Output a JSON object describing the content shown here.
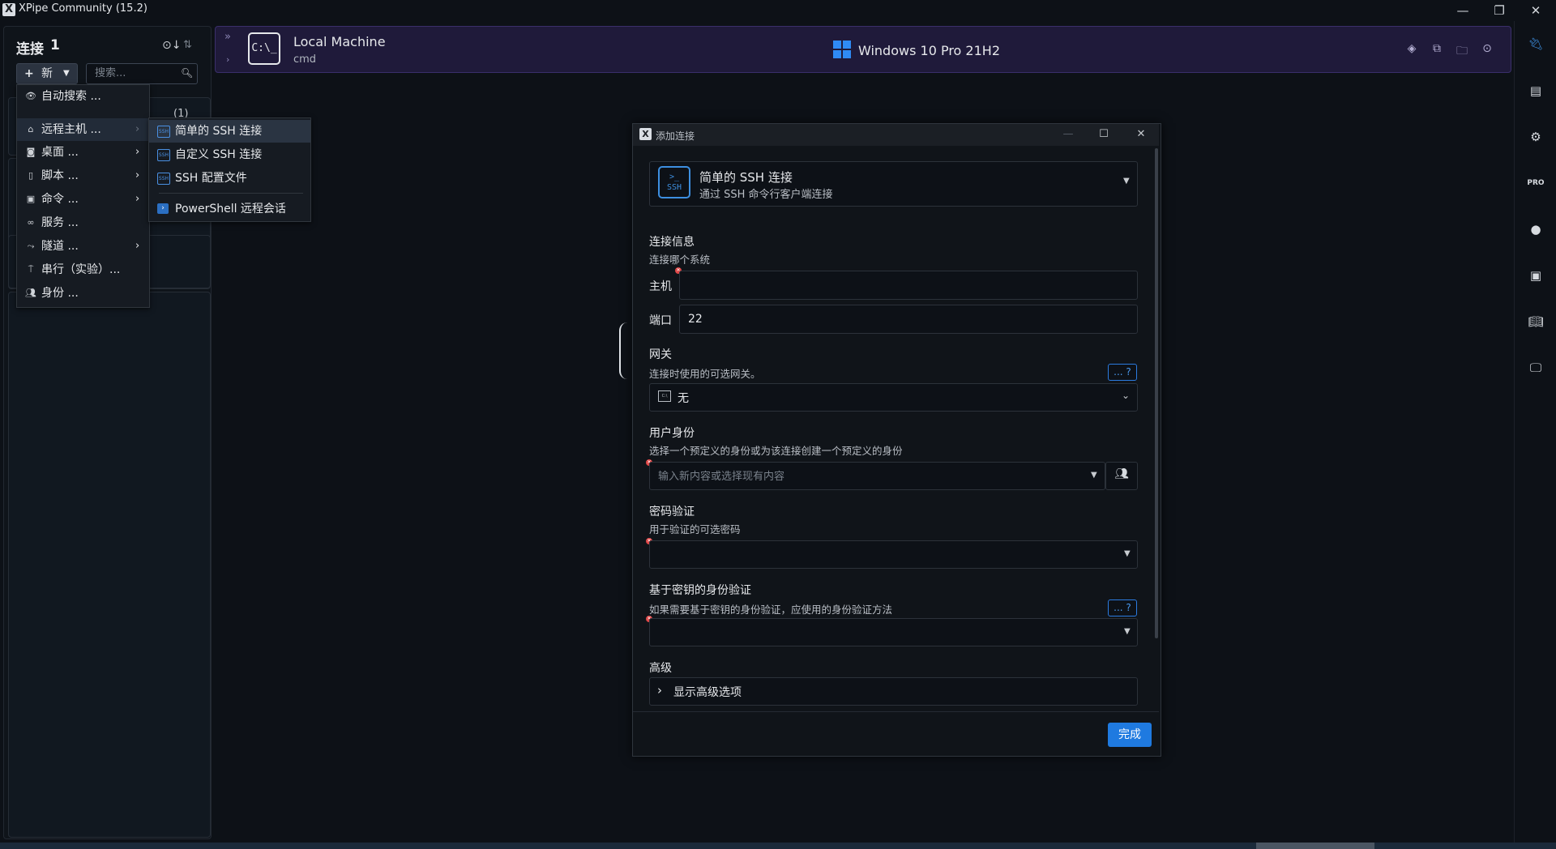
{
  "window": {
    "title": "XPipe Community (15.2)",
    "logo_glyph": "X",
    "minimize": "—",
    "restore": "❐",
    "close": "✕"
  },
  "sidebar": {
    "title": "连接",
    "count": "1",
    "new_button": "新",
    "search_placeholder": "搜索...",
    "card_count": "(1)"
  },
  "new_menu": {
    "items": [
      {
        "label": "自动搜索 ...",
        "icon": "auto-search-icon",
        "has_submenu": false
      },
      {
        "label": "远程主机 ...",
        "icon": "remote-host-icon",
        "has_submenu": true
      },
      {
        "label": "桌面 ...",
        "icon": "desktop-icon",
        "has_submenu": true
      },
      {
        "label": "脚本 ...",
        "icon": "script-icon",
        "has_submenu": true
      },
      {
        "label": "命令 ...",
        "icon": "command-icon",
        "has_submenu": true
      },
      {
        "label": "服务 ...",
        "icon": "service-icon",
        "has_submenu": false
      },
      {
        "label": "隧道 ...",
        "icon": "tunnel-icon",
        "has_submenu": true
      },
      {
        "label": "串行（实验）...",
        "icon": "serial-icon",
        "has_submenu": false
      },
      {
        "label": "身份 ...",
        "icon": "identity-icon",
        "has_submenu": false
      }
    ]
  },
  "sub_menu": {
    "items": [
      {
        "label": "简单的 SSH 连接",
        "icon": "ssh-icon"
      },
      {
        "label": "自定义 SSH 连接",
        "icon": "custom-ssh-icon"
      },
      {
        "label": "SSH 配置文件",
        "icon": "ssh-config-icon"
      },
      {
        "label": "PowerShell 远程会话",
        "icon": "powershell-icon"
      }
    ]
  },
  "header": {
    "machine_name": "Local Machine",
    "shell": "cmd",
    "cmd_icon_text": "C:\\_",
    "os_name": "Windows 10 Pro 21H2"
  },
  "dialog": {
    "title": "添加连接",
    "type_name": "简单的 SSH 连接",
    "type_desc": "通过 SSH 命令行客户端连接",
    "ssh_icon_text": ">_ SSH",
    "conn_info_title": "连接信息",
    "conn_info_desc": "连接哪个系统",
    "host_label": "主机",
    "host_value": "",
    "port_label": "端口",
    "port_value": "22",
    "gateway_title": "网关",
    "gateway_desc": "连接时使用的可选网关。",
    "gateway_help": "... ?",
    "gateway_value": "无",
    "identity_title": "用户身份",
    "identity_desc": "选择一个预定义的身份或为该连接创建一个预定义的身份",
    "identity_placeholder": "输入新内容或选择现有内容",
    "password_title": "密码验证",
    "password_desc": "用于验证的可选密码",
    "key_title": "基于密钥的身份验证",
    "key_desc": "如果需要基于密钥的身份验证，应使用的身份验证方法",
    "key_help": "... ?",
    "advanced_title": "高级",
    "advanced_toggle": "显示高级选项",
    "done_button": "完成"
  },
  "colors": {
    "accent": "#1f7ae0",
    "header_bg": "#1f1a3a",
    "error": "#e04848"
  }
}
